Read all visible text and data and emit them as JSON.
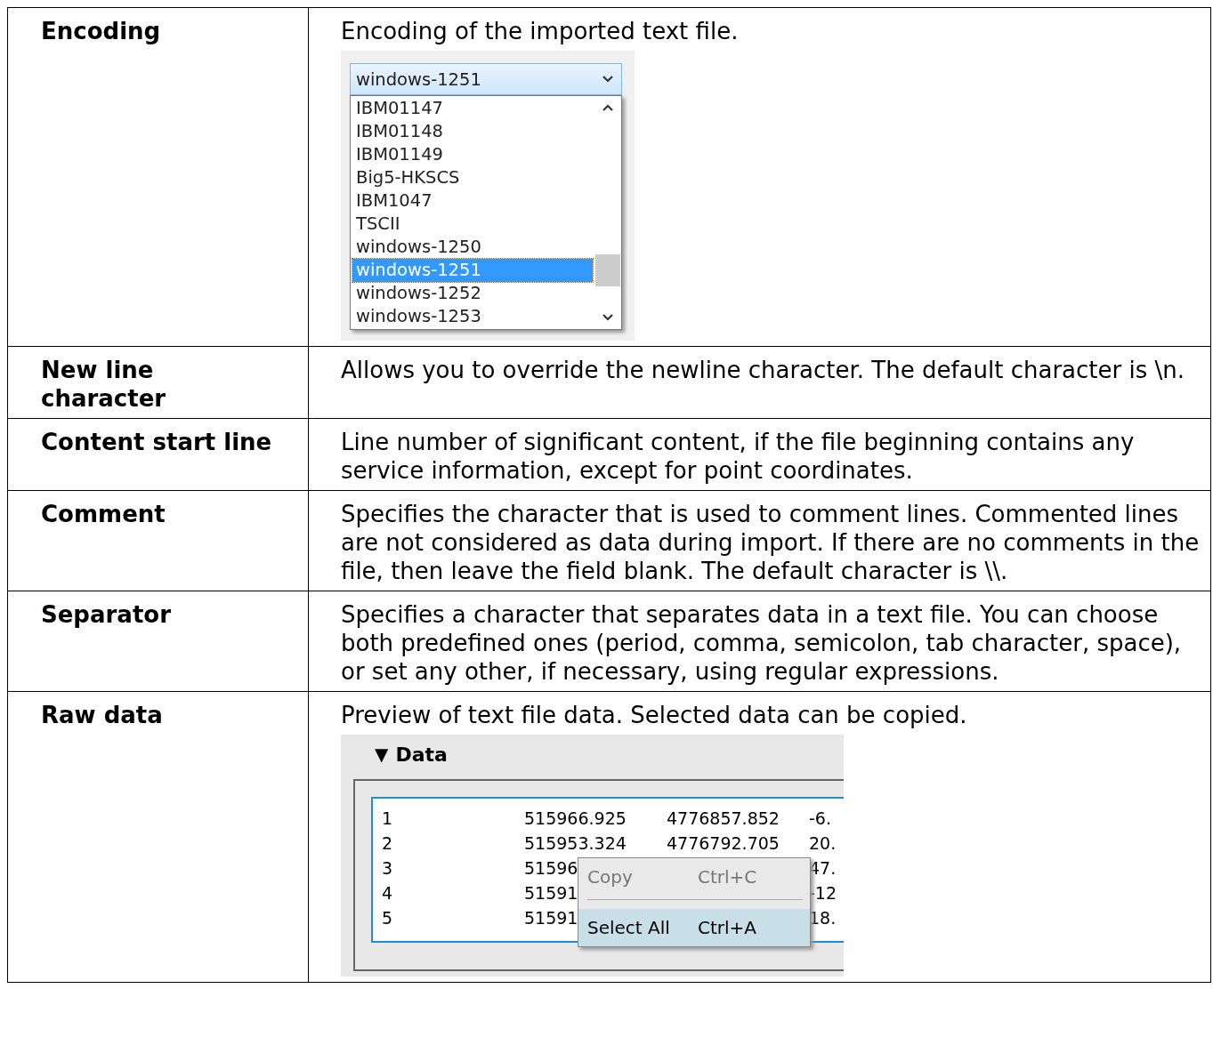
{
  "rows": [
    {
      "term": "Encoding",
      "description": "Encoding of the imported text file.",
      "kind": "dropdown"
    },
    {
      "term": "New line character",
      "description": "Allows you to override the newline character. The default character is \\n.",
      "kind": "text"
    },
    {
      "term": "Content start line",
      "description": "Line number of significant content, if the file beginning contains any service information, except for point coordinates.",
      "kind": "text"
    },
    {
      "term": "Comment",
      "description": "Specifies the character that is used to comment lines. Commented lines are not considered as data during import. If there are no comments in the file, then leave the field blank. The default character is \\\\.",
      "kind": "text"
    },
    {
      "term": "Separator",
      "description": "Specifies a character that separates data in a text file. You can choose both predefined ones (period, comma, semicolon, tab character, space), or set any other, if necessary, using regular expressions.",
      "kind": "text"
    },
    {
      "term": "Raw data",
      "description": "Preview of text file data. Selected data can be copied.",
      "kind": "data"
    }
  ],
  "dropdown": {
    "value": "windows-1251",
    "options": [
      {
        "label": "IBM01147",
        "selected": false
      },
      {
        "label": "IBM01148",
        "selected": false
      },
      {
        "label": "IBM01149",
        "selected": false
      },
      {
        "label": "Big5-HKSCS",
        "selected": false
      },
      {
        "label": "IBM1047",
        "selected": false
      },
      {
        "label": "TSCII",
        "selected": false
      },
      {
        "label": "windows-1250",
        "selected": false
      },
      {
        "label": "windows-1251",
        "selected": true
      },
      {
        "label": "windows-1252",
        "selected": false
      },
      {
        "label": "windows-1253",
        "selected": false
      }
    ]
  },
  "data_panel": {
    "toggle": "▼",
    "title": "Data",
    "rows": [
      {
        "number": "1",
        "col_2": "515966.925",
        "col_3": "4776857.852",
        "col_4": "-6."
      },
      {
        "number": "2",
        "col_2": "515953.324",
        "col_3": "4776792.705",
        "col_4": "20."
      },
      {
        "number": "3",
        "col_2": "51596",
        "col_4": "47."
      },
      {
        "number": "4",
        "col_2": "51591",
        "col_4": "-12"
      },
      {
        "number": "5",
        "col_2": "51591",
        "col_4": "18."
      }
    ],
    "context_menu": [
      {
        "label": "Copy",
        "shortcut": "Ctrl+C",
        "disabled": true,
        "highlighted": false
      },
      {
        "label": "Select All",
        "shortcut": "Ctrl+A",
        "disabled": false,
        "highlighted": true
      }
    ]
  }
}
